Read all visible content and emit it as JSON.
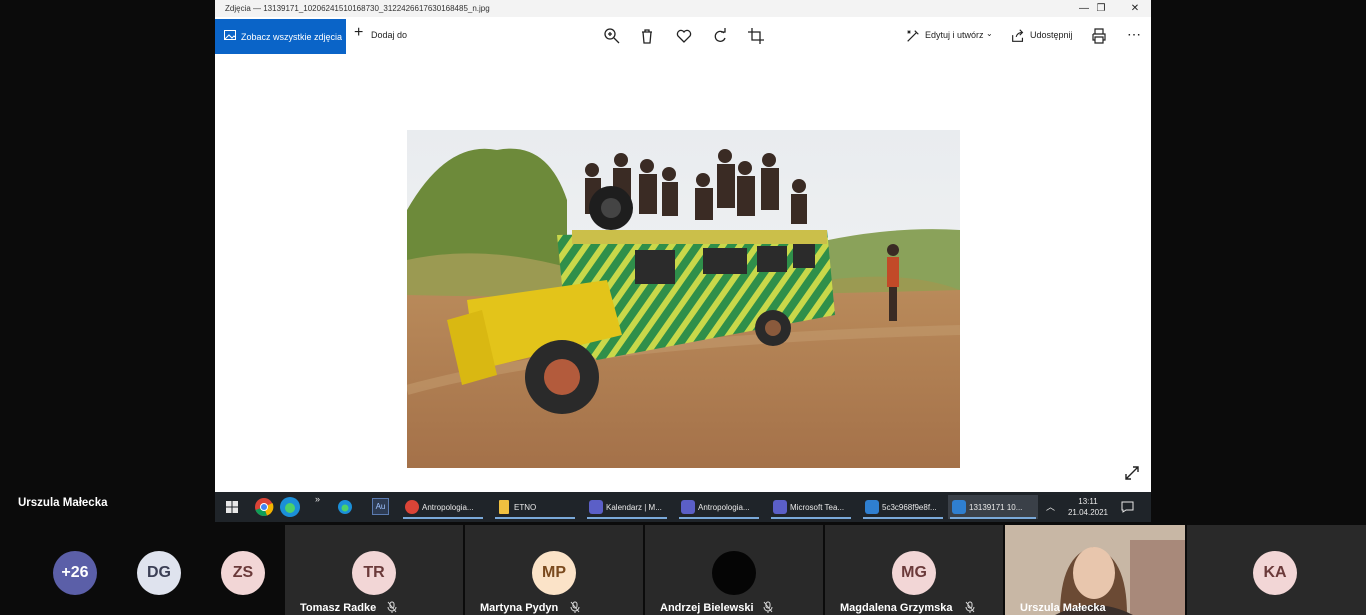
{
  "window": {
    "title": "Zdjęcia — 13139171_10206241510168730_3122426617630168485_n.jpg"
  },
  "toolbar": {
    "view_all_label": "Zobacz wszystkie zdjęcia",
    "add_to_label": "Dodaj do",
    "edit_label": "Edytuj i utwórz",
    "share_label": "Udostępnij"
  },
  "taskbar": {
    "items": [
      {
        "label": "Antropologia..."
      },
      {
        "label": "ETNO"
      },
      {
        "label": "Kalendarz | M..."
      },
      {
        "label": "Antropologia..."
      },
      {
        "label": "Microsoft Tea..."
      },
      {
        "label": "5c3c968f9e8f..."
      },
      {
        "label": "13139171 10..."
      }
    ],
    "time": "13:11",
    "date": "21.04.2021"
  },
  "presenter": {
    "name": "Urszula Małecka"
  },
  "participants": {
    "overflow": "+26",
    "small": [
      {
        "initials": "DG"
      },
      {
        "initials": "ZS"
      }
    ],
    "tiles": [
      {
        "initials": "TR",
        "name": "Tomasz Radke"
      },
      {
        "initials": "MP",
        "name": "Martyna Pydyn"
      },
      {
        "initials": "",
        "name": "Andrzej Bielewski"
      },
      {
        "initials": "MG",
        "name": "Magdalena Grzymska"
      },
      {
        "initials": "",
        "name": "Urszula Małecka"
      },
      {
        "initials": "KA",
        "name": ""
      }
    ]
  },
  "colors": {
    "accent": "#0a64c8",
    "avatar_bg": "#f2d6d6",
    "avatar_text": "#6b3a3a",
    "overflow_bg": "#5b5fa8"
  }
}
